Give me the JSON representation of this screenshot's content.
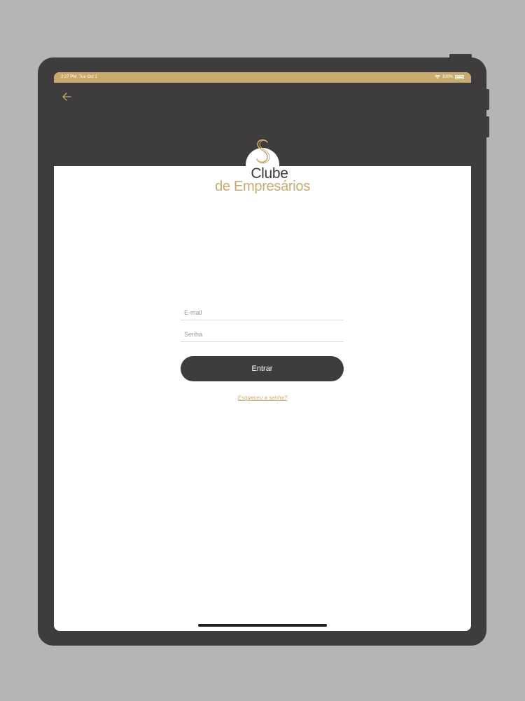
{
  "status_bar": {
    "time": "2:27 PM",
    "date": "Tue Oct 1",
    "battery": "100%",
    "icons": [
      "wifi-icon",
      "battery-icon"
    ]
  },
  "header": {
    "back_icon": "arrow-left-icon"
  },
  "logo": {
    "line1": "Clube",
    "line2": "de Empresários"
  },
  "form": {
    "email_placeholder": "E-mail",
    "email_value": "",
    "password_placeholder": "Senha",
    "password_value": "",
    "submit_label": "Entrar",
    "forgot_label": "Esqueceu a senha?"
  },
  "colors": {
    "accent": "#c8a96e",
    "dark": "#3e3c3d",
    "background": "#ffffff",
    "frame_background": "#b6b5b6"
  }
}
